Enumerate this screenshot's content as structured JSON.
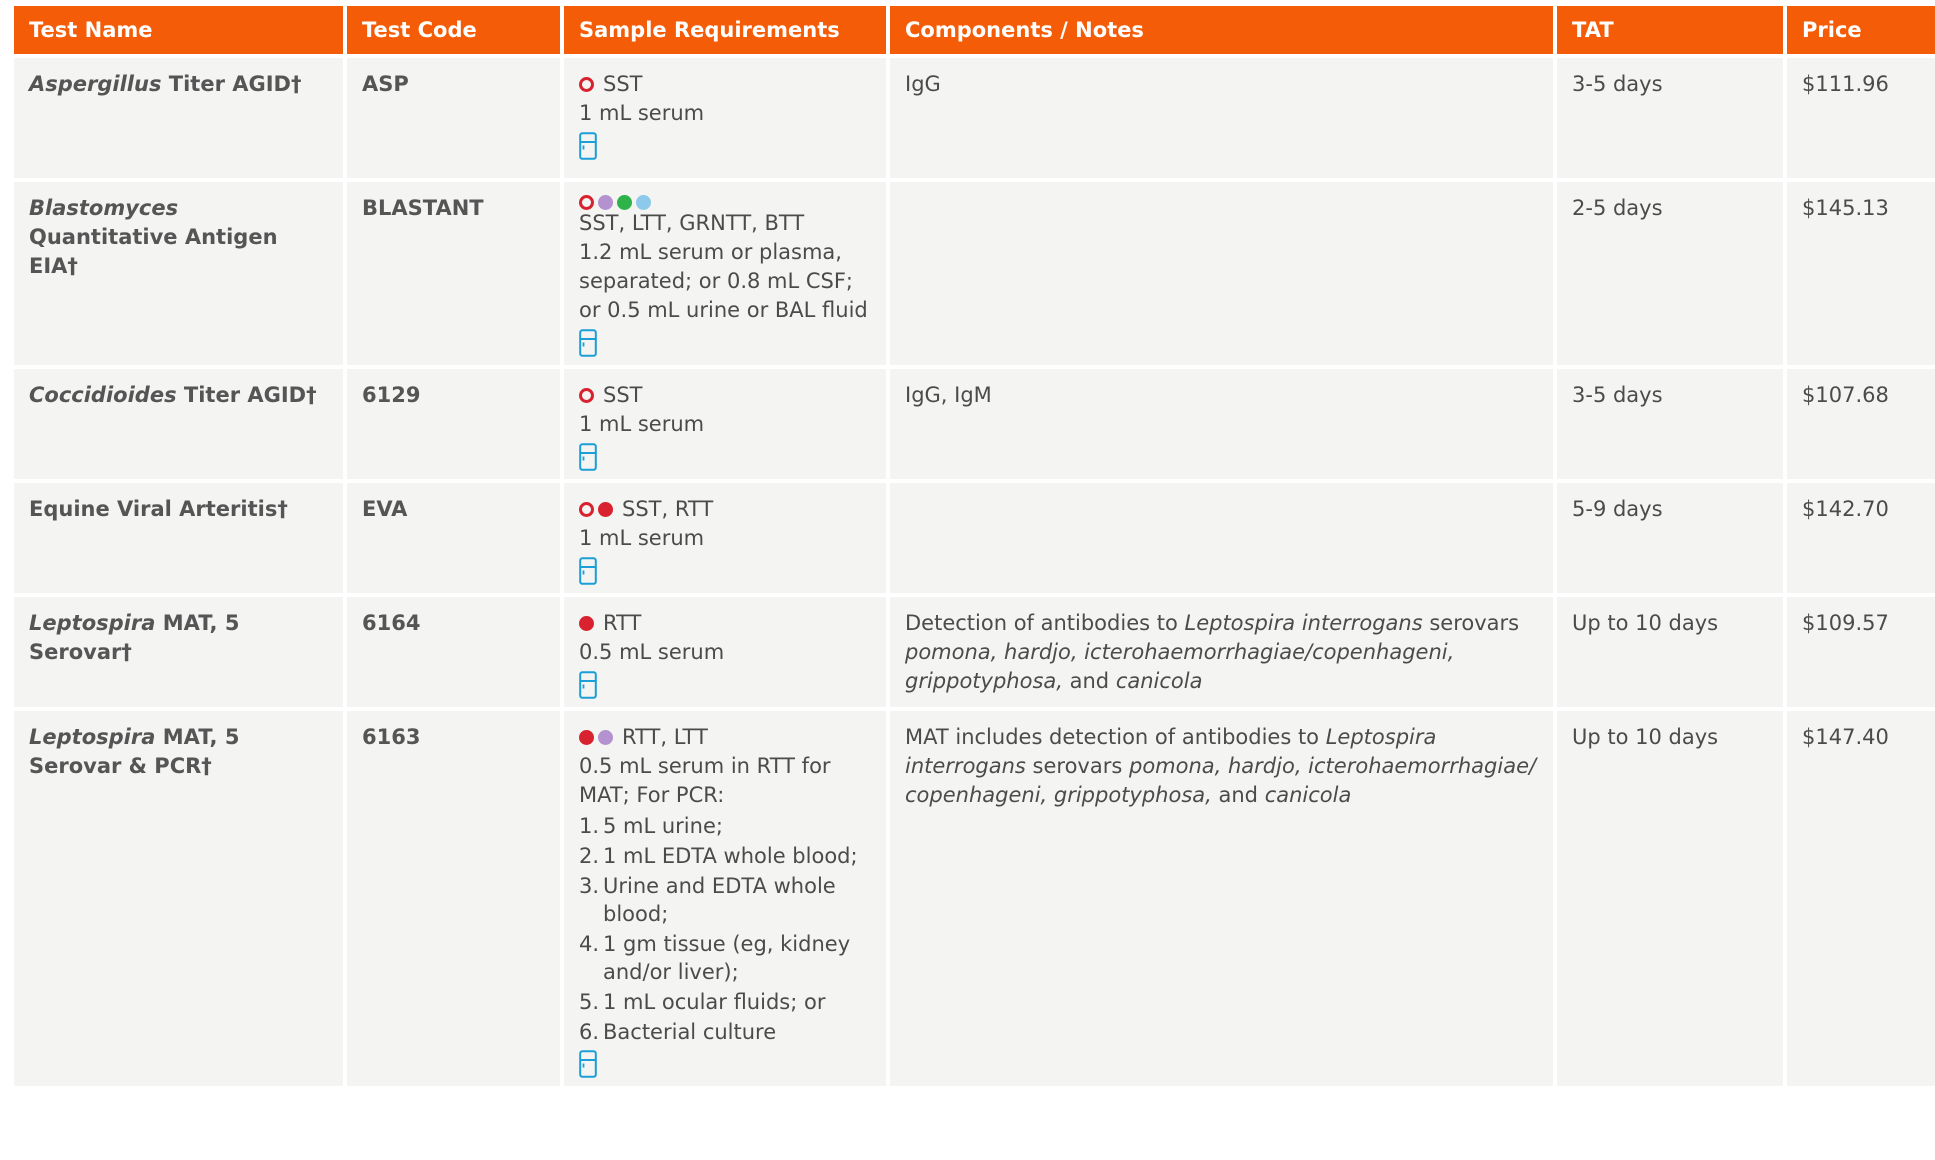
{
  "colors": {
    "header_bg": "#f55c07",
    "cell_bg": "#f4f4f3",
    "text": "#4b4b4b",
    "dot_red": "#d9222f",
    "dot_purple": "#b492cf",
    "dot_green": "#2db34a",
    "dot_blue": "#8cc9ea",
    "icon_blue": "#1b9fd6"
  },
  "headers": [
    "Test Name",
    "Test Code",
    "Sample Requirements",
    "Components / Notes",
    "TAT",
    "Price"
  ],
  "rows": [
    {
      "name_italic": "Aspergillus",
      "name_rest": " Titer AGID†",
      "code": "ASP",
      "dots": [
        "red-outline"
      ],
      "tubes": "SST",
      "sample_detail": "1 mL serum",
      "icon": "refrigerator-icon",
      "notes_parts": [
        {
          "t": "IgG"
        }
      ],
      "tat": "3-5 days",
      "price": "$111.96"
    },
    {
      "name_italic": "Blastomyces",
      "name_rest": " Quantitative Antigen EIA†",
      "code": "BLASTANT",
      "dots": [
        "red-outline",
        "purple",
        "green",
        "blue"
      ],
      "tubes": "SST, LTT, GRNTT, BTT",
      "sample_detail": "1.2 mL serum or plasma, separated; or 0.8 mL CSF; or 0.5 mL urine or BAL fluid",
      "icon": "refrigerator-icon",
      "notes_parts": [],
      "tat": "2-5 days",
      "price": "$145.13"
    },
    {
      "name_italic": "Coccidioides",
      "name_rest": " Titer AGID†",
      "code": "6129",
      "dots": [
        "red-outline"
      ],
      "tubes": "SST",
      "sample_detail": "1 mL serum",
      "icon": "refrigerator-icon",
      "notes_parts": [
        {
          "t": "IgG, IgM"
        }
      ],
      "tat": "3-5 days",
      "price": "$107.68"
    },
    {
      "name_italic": "",
      "name_rest": "Equine Viral Arteritis†",
      "code": "EVA",
      "dots": [
        "red-outline",
        "red"
      ],
      "tubes": "SST, RTT",
      "sample_detail": "1 mL serum",
      "icon": "refrigerator-icon",
      "notes_parts": [],
      "tat": "5-9 days",
      "price": "$142.70"
    },
    {
      "name_italic": "Leptospira",
      "name_rest": " MAT, 5 Serovar†",
      "code": "6164",
      "dots": [
        "red"
      ],
      "tubes": "RTT",
      "sample_detail": "0.5 mL serum",
      "icon": "refrigerator-icon",
      "notes_parts": [
        {
          "t": "Detection of antibodies to "
        },
        {
          "t": "Leptospira interrogans",
          "i": true
        },
        {
          "t": " serovars "
        },
        {
          "t": "pomona, hardjo, icterohaemorrhagiae/copenhageni, grippotyphosa,",
          "i": true
        },
        {
          "t": " and "
        },
        {
          "t": "canicola",
          "i": true
        }
      ],
      "tat": "Up to 10 days",
      "price": "$109.57"
    },
    {
      "name_italic": "Leptospira",
      "name_rest": " MAT, 5 Serovar & PCR†",
      "code": "6163",
      "dots": [
        "red",
        "purple"
      ],
      "tubes": "RTT, LTT",
      "sample_detail": "0.5 mL serum in RTT for MAT; For PCR:",
      "options": [
        {
          "n": "1.",
          "t": "5 mL urine;"
        },
        {
          "n": "2.",
          "t": "1 mL EDTA whole blood;"
        },
        {
          "n": "3.",
          "t": "Urine and EDTA whole blood;"
        },
        {
          "n": "4.",
          "t": "1 gm tissue (eg, kidney and/or liver);"
        },
        {
          "n": "5.",
          "t": "1 mL ocular fluids; or"
        },
        {
          "n": "6.",
          "t": "Bacterial culture"
        }
      ],
      "icon": "refrigerator-icon",
      "notes_parts": [
        {
          "t": "MAT includes detection of antibodies to "
        },
        {
          "t": "Leptospira interrogans",
          "i": true
        },
        {
          "t": " serovars "
        },
        {
          "t": "pomona, hardjo, icterohaemorrhagiae/ copenhageni, grippotyphosa,",
          "i": true
        },
        {
          "t": " and "
        },
        {
          "t": "canicola",
          "i": true
        }
      ],
      "tat": "Up to 10 days",
      "price": "$147.40"
    }
  ]
}
